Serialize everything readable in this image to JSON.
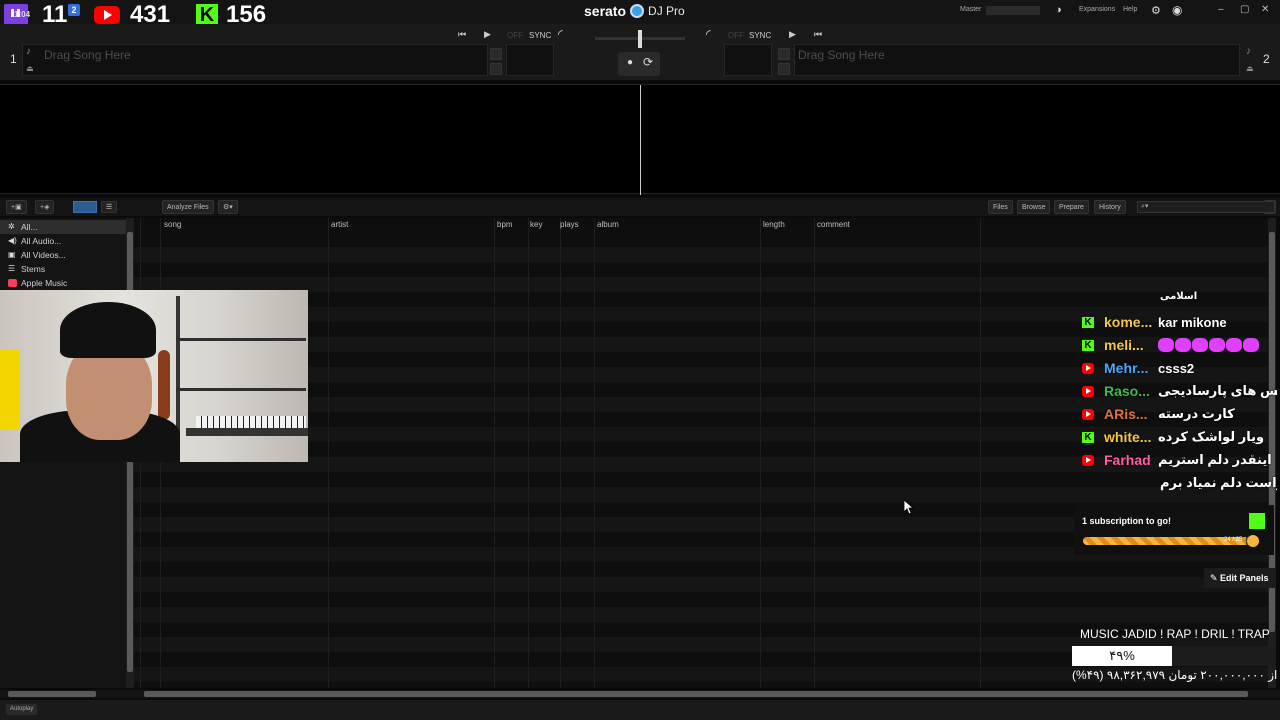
{
  "stream": {
    "twitch_viewers": "11",
    "twitch_badge": "2",
    "twitch_mini": "1:04",
    "youtube_viewers": "431",
    "kick_viewers": "156"
  },
  "app": {
    "brand": "serato",
    "product": "DJ Pro",
    "master_label": "Master",
    "expansions_label": "Expansions",
    "help_label": "Help"
  },
  "decks": {
    "left": {
      "number": "1",
      "placeholder": "Drag Song Here",
      "sync_label": "SYNC",
      "off_label": "OFF"
    },
    "right": {
      "number": "2",
      "placeholder": "Drag Song Here",
      "sync_label": "SYNC",
      "off_label": "OFF"
    }
  },
  "library": {
    "analyze_label": "Analyze Files",
    "tabs": [
      "Files",
      "Browse",
      "Prepare",
      "History"
    ],
    "columns": [
      "song",
      "artist",
      "bpm",
      "key",
      "plays",
      "album",
      "length",
      "comment"
    ],
    "crates": [
      "All...",
      "All Audio...",
      "All Videos...",
      "Stems",
      "Apple Music"
    ],
    "autoplay_label": "Autoplay"
  },
  "chat": {
    "top_fragment": "اسلامی",
    "messages": [
      {
        "platform": "kick",
        "user": "kome...",
        "text": "kar mikone",
        "color": "#f6c64a"
      },
      {
        "platform": "kick",
        "user": "meli...",
        "text": "",
        "color": "#f6c64a",
        "emotes": 6
      },
      {
        "platform": "youtube",
        "user": "Mehr...",
        "text": "csss2",
        "color": "#4ea6ff"
      },
      {
        "platform": "youtube",
        "user": "Raso...",
        "text": "ریمیکس های پارسادیجی",
        "color": "#3fb950"
      },
      {
        "platform": "youtube",
        "user": "ARis...",
        "text": "کارت درسته",
        "color": "#e0743a"
      },
      {
        "platform": "kick",
        "user": "white...",
        "text": "ویار لواشک کرده",
        "color": "#f6c64a"
      },
      {
        "platform": "youtube",
        "user": "Farhad",
        "text": "اینقدر دلم استریم",
        "color": "#ff5fa8"
      },
      {
        "platform": "none",
        "user": "",
        "text": "میخواست دلم نمیاد برم",
        "color": "#ffffff"
      }
    ]
  },
  "goal": {
    "title": "1 subscription to go!",
    "count": "24 / 25",
    "progress": 0.96,
    "edit_label": "Edit Panels"
  },
  "donation": {
    "title": "MUSIC JADID ! RAP ! DRIL ! TRAP",
    "percent_label": "۴۹%",
    "progress": 0.49,
    "detail": "(%۴۹) ۹۸,۳۶۲,۹۷۹ از ۲۰۰,۰۰۰,۰۰۰ تومان"
  },
  "colors": {
    "accent_blue": "#2b5d91",
    "twitch": "#7b3fe4",
    "youtube": "#ff0000",
    "kick": "#53fc18"
  }
}
